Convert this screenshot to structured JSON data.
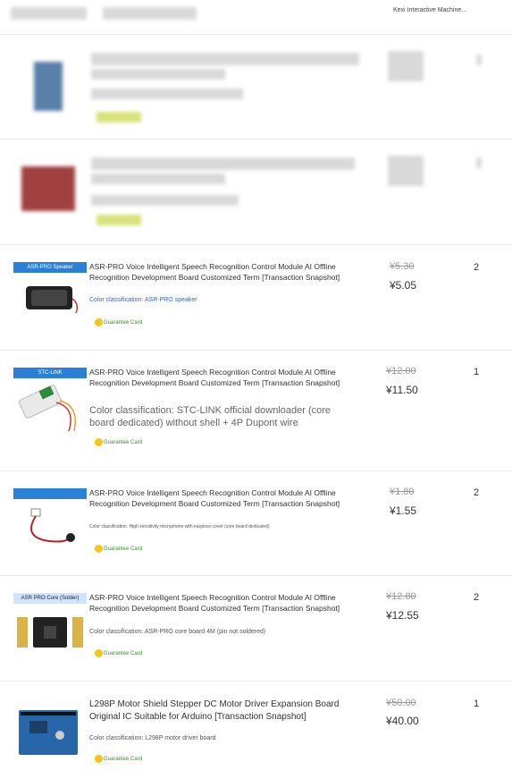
{
  "header": {
    "shop_name": "Kexi Interactive Machine..."
  },
  "items": [
    {
      "title": "ASR-PRO Voice Intelligent Speech Recognition Control Module AI Offline Recognition Development Board Customized Term [Transaction Snapshot]",
      "thumb_label": "ASR-PRO Speaker",
      "classification": "Color classification: ASR-PRO speaker",
      "guarantee": "Guarantee Card",
      "original_price": "¥5.30",
      "price": "¥5.05",
      "quantity": "2"
    },
    {
      "title": "ASR-PRO Voice Intelligent Speech Recognition Control Module AI Offline Recognition Development Board Customized Term [Transaction Snapshot]",
      "thumb_label": "STC-LINK",
      "classification": "Color classification: STC-LINK official downloader (core board dedicated) without shell + 4P Dupont wire",
      "guarantee": "Guarantee Card",
      "original_price": "¥12.00",
      "price": "¥11.50",
      "quantity": "1"
    },
    {
      "title": "ASR-PRO Voice Intelligent Speech Recognition Control Module AI Offline Recognition Development Board Customized Term [Transaction Snapshot]",
      "thumb_label": "",
      "classification": "Color classification: High sensitivity microphone with earpiece cover (core board dedicated)",
      "guarantee": "Guarantee Card",
      "original_price": "¥1.80",
      "price": "¥1.55",
      "quantity": "2"
    },
    {
      "title": "ASR-PRO Voice Intelligent Speech Recognition Control Module AI Offline Recognition Development Board Customized Term [Transaction Snapshot]",
      "thumb_label": "ASR PRO Core (Solder)",
      "classification": "Color classification: ASR-PRO core board 4M (pin not soldered)",
      "guarantee": "Guarantee Card",
      "original_price": "¥12.80",
      "price": "¥12.55",
      "quantity": "2"
    },
    {
      "title": "L298P Motor Shield Stepper DC Motor Driver Expansion Board Original IC Suitable for Arduino [Transaction Snapshot]",
      "thumb_label": "",
      "classification": "Color classification: L298P motor driver board",
      "guarantee": "Guarantee Card",
      "original_price": "¥50.00",
      "price": "¥40.00",
      "quantity": "1"
    }
  ]
}
